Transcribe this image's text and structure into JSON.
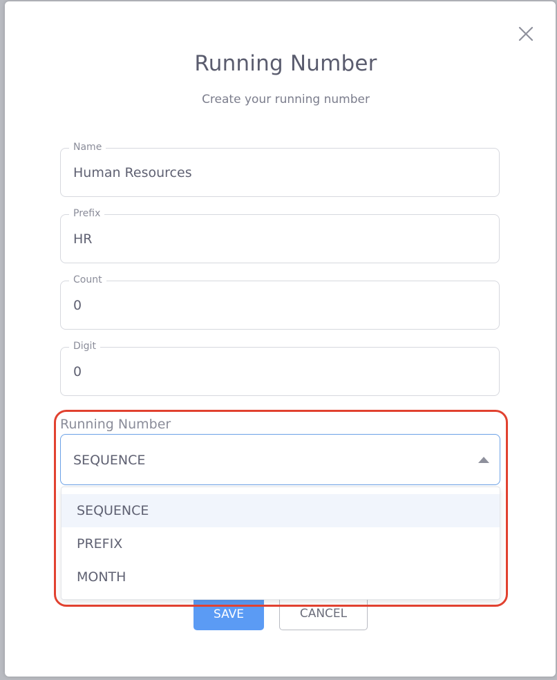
{
  "dialog": {
    "title": "Running Number",
    "subtitle": "Create your running number",
    "close_icon": "close-icon"
  },
  "fields": {
    "name": {
      "label": "Name",
      "value": "Human Resources"
    },
    "prefix": {
      "label": "Prefix",
      "value": "HR"
    },
    "count": {
      "label": "Count",
      "value": "0"
    },
    "digit": {
      "label": "Digit",
      "value": "0"
    }
  },
  "running_number": {
    "label": "Running Number",
    "selected": "SEQUENCE",
    "options": [
      "SEQUENCE",
      "PREFIX",
      "MONTH"
    ]
  },
  "actions": {
    "save_label": "SAVE",
    "cancel_label": "CANCEL"
  },
  "colors": {
    "accent": "#5b9bf4",
    "focus_border": "#6aa0e6",
    "highlight": "#e1412f",
    "text": "#5f6172"
  }
}
